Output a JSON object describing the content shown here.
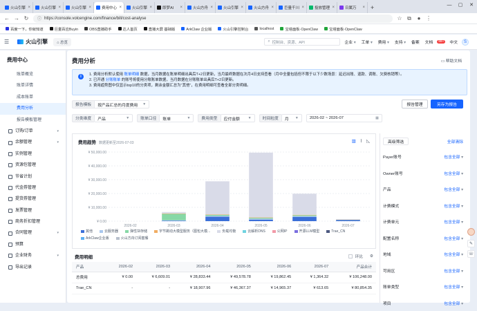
{
  "browser": {
    "tabs": [
      {
        "label": "火山引擎",
        "color": "#1664ff"
      },
      {
        "label": "火山引擎",
        "color": "#1664ff"
      },
      {
        "label": "火山引擎",
        "color": "#1664ff"
      },
      {
        "label": "费用中心",
        "color": "#1664ff",
        "active": true
      },
      {
        "label": "火山引擎",
        "color": "#1664ff"
      },
      {
        "label": "即梦AI",
        "color": "#111111"
      },
      {
        "label": "火山方舟",
        "color": "#1664ff"
      },
      {
        "label": "火山引擎",
        "color": "#1664ff"
      },
      {
        "label": "火山方舟",
        "color": "#1664ff"
      },
      {
        "label": "巨量千川",
        "color": "#1664ff"
      },
      {
        "label": "投放管理",
        "color": "#00b96b"
      },
      {
        "label": "日属万",
        "color": "#7c3aed"
      }
    ],
    "url": "https://console.volcengine.com/finance/bill/cost-analyse",
    "bookmarks": [
      {
        "label": "百度一下，你就知道",
        "color": "#2932e1"
      },
      {
        "label": "巨量百应Buyin",
        "color": "#111111"
      },
      {
        "label": "OBS直播助手",
        "color": "#333333"
      },
      {
        "label": "达人首页",
        "color": "#111111"
      },
      {
        "label": "直播大屏 基础版",
        "color": "#111111"
      },
      {
        "label": "ArkClaw 企业版",
        "color": "#1664ff"
      },
      {
        "label": "火山引擎控制台",
        "color": "#1664ff"
      },
      {
        "label": "localhost",
        "color": "#555555"
      },
      {
        "label": "宝塔面板·OpenClaw",
        "color": "#20a53a"
      },
      {
        "label": "宝塔面板·OpenClaw",
        "color": "#20a53a"
      }
    ]
  },
  "header": {
    "brand": "火山引擎",
    "home": "总览",
    "search_placeholder": "控制台、资源、API",
    "nav": [
      "企业",
      "工单",
      "费用",
      "支持",
      "备案",
      "文档"
    ],
    "badge": "99+",
    "lang": "中文",
    "avatar": "S"
  },
  "sidebar": {
    "title": "费用中心",
    "items": [
      "账单概览",
      "账单详情",
      "成本账单",
      "费用分析",
      "报告模板管理"
    ],
    "active_index": 3,
    "groups": [
      "订购/订单",
      "余额管理",
      "实例管理",
      "资源包管理",
      "节省计划",
      "代金券管理",
      "提货券管理",
      "发票管理",
      "商务折扣管理",
      "合同管理",
      "预算",
      "企业财务",
      "导出记录"
    ]
  },
  "page": {
    "title": "费用分析",
    "help": "帮助文档",
    "notice": [
      {
        "pre": "1. 费用分析默认使用 ",
        "link": "账单明细",
        "post": " 数据，当月数据在账单明细出具后T+2日更新，当月最终数据在次月4日支持查看（月中全量包括但不限于以下少数场景：延迟出账、退款、调账、欠费核销等）。"
      },
      {
        "pre": "2. 已开通 ",
        "link": "分账账单",
        "post": " 的账号将使用分账账单数据，当月数据在分账账单出具后T+2日更新。"
      },
      {
        "pre": "3. 费用趋势图中仅显示top10的分类项，剩余金额汇总为\"其他\"，在费用明细可查看全部分类明细。",
        "link": "",
        "post": ""
      }
    ],
    "report_template_label": "报告模板",
    "report_template_value": "按产品汇总的月度费用",
    "report_mgmt": "报告管理",
    "save_report": "另存为报告",
    "filters": {
      "dim_label": "分类维度",
      "dim_value": "产品",
      "bill_label": "账单口径",
      "bill_value": "账单",
      "cost_label": "费用类型",
      "cost_value": "应付金额",
      "time_label": "时间粒度",
      "time_value": "月",
      "date_range": "2026-02 ~ 2026-07"
    }
  },
  "chart_section": {
    "title": "费用趋势",
    "note": "数据更新至2026-07-03"
  },
  "chart_data": {
    "type": "bar",
    "stacked": true,
    "categories": [
      "2026-02",
      "2026-03",
      "2026-04",
      "2026-05",
      "2026-06",
      "2026-07"
    ],
    "y_ticks": [
      "¥ 0.00",
      "¥ 10,000.00",
      "¥ 20,000.00",
      "¥ 30,000.00",
      "¥ 40,000.00",
      "¥ 50,000.00"
    ],
    "ylim": [
      0,
      50000
    ],
    "series": [
      {
        "name": "其他",
        "color": "#3b6fd8",
        "values": [
          0,
          260,
          3200,
          1000,
          3000,
          900
        ]
      },
      {
        "name": "云服务器",
        "color": "#a9c7ee",
        "values": [
          0,
          400,
          600,
          800,
          700,
          200
        ]
      },
      {
        "name": "弹性块存储",
        "color": "#87d8a6",
        "values": [
          0,
          4600,
          700,
          700,
          600,
          100
        ]
      },
      {
        "name": "字节跳动大模型服务（图包大模...",
        "color": "#f1ad63",
        "values": [
          0,
          300,
          300,
          200,
          300,
          40
        ]
      },
      {
        "name": "负载均衡",
        "color": "#d9dbe8",
        "values": [
          0,
          1049,
          24034,
          46878,
          15263,
          124
        ]
      },
      {
        "name": "云解析DNS",
        "color": "#70d3e0",
        "values": [
          0,
          0,
          0,
          0,
          0,
          0
        ]
      },
      {
        "name": "公网IP",
        "color": "#f29aa8",
        "values": [
          0,
          0,
          0,
          0,
          0,
          0
        ]
      },
      {
        "name": "开源LLM模型",
        "color": "#7b6ee0",
        "values": [
          0,
          0,
          0,
          0,
          0,
          0
        ]
      },
      {
        "name": "Trae_CN",
        "color": "#4d5980",
        "values": [
          0,
          0,
          0,
          0,
          0,
          0
        ]
      },
      {
        "name": "ArkClaw企业版",
        "color": "#5fb0f2",
        "values": [
          0,
          0,
          0,
          0,
          0,
          0
        ]
      },
      {
        "name": "火山方舟订阅套餐",
        "color": "#b8bfcc",
        "values": [
          0,
          0,
          0,
          0,
          0,
          0
        ]
      }
    ]
  },
  "filter_panel": {
    "advanced": "高级筛选",
    "clear": "全部清除",
    "rows": [
      {
        "label": "Payer账号",
        "value": "包含全部"
      },
      {
        "label": "Owner账号",
        "value": "包含全部"
      },
      {
        "label": "产品",
        "value": "包含全部"
      },
      {
        "label": "计费模式",
        "value": "包含全部"
      },
      {
        "label": "计费单元",
        "value": "包含全部"
      },
      {
        "label": "配置名称",
        "value": "包含全部"
      },
      {
        "label": "地域",
        "value": "包含全部"
      },
      {
        "label": "可用区",
        "value": "包含全部"
      },
      {
        "label": "账单类型",
        "value": "包含全部"
      },
      {
        "label": "项目",
        "value": "包含全部"
      }
    ]
  },
  "table": {
    "title": "费用明细",
    "yoy_label": "环比",
    "headers": [
      "产品",
      "2026-02",
      "2026-03",
      "2026-04",
      "2026-05",
      "2026-06",
      "2026-07",
      "产品合计"
    ],
    "rows": [
      [
        "总费用",
        "¥ 0.00",
        "¥ 6,609.01",
        "¥ 28,833.44",
        "¥ 49,578.78",
        "¥ 19,862.45",
        "¥ 1,364.32",
        "¥ 106,248.00"
      ],
      [
        "Trae_CN",
        "-",
        "-",
        "¥ 18,907.96",
        "¥ 46,367.37",
        "¥ 14,965.37",
        "¥ 613.65",
        "¥ 80,854.35"
      ]
    ]
  }
}
